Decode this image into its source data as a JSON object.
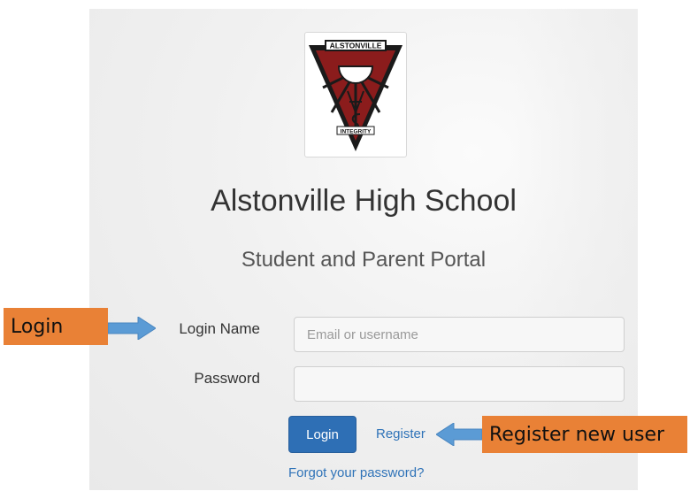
{
  "logo": {
    "banner_text": "ALSTONVILLE",
    "motto_text": "INTEGRITY",
    "colors": {
      "red": "#8b1c1c",
      "dark": "#1a1a1a",
      "white": "#ffffff"
    }
  },
  "header": {
    "school_name": "Alstonville High School",
    "portal_name": "Student and Parent Portal"
  },
  "form": {
    "login_name_label": "Login Name",
    "login_name_placeholder": "Email or username",
    "login_name_value": "",
    "password_label": "Password",
    "password_value": "",
    "login_button": "Login",
    "register_link": "Register",
    "forgot_link": "Forgot your password?"
  },
  "annotations": {
    "login_callout": "Login",
    "register_callout": "Register new user",
    "callout_color": "#e98136",
    "arrow_color": "#5b9bd5"
  },
  "colors": {
    "primary": "#2e6fb5",
    "link": "#2f73b8"
  }
}
